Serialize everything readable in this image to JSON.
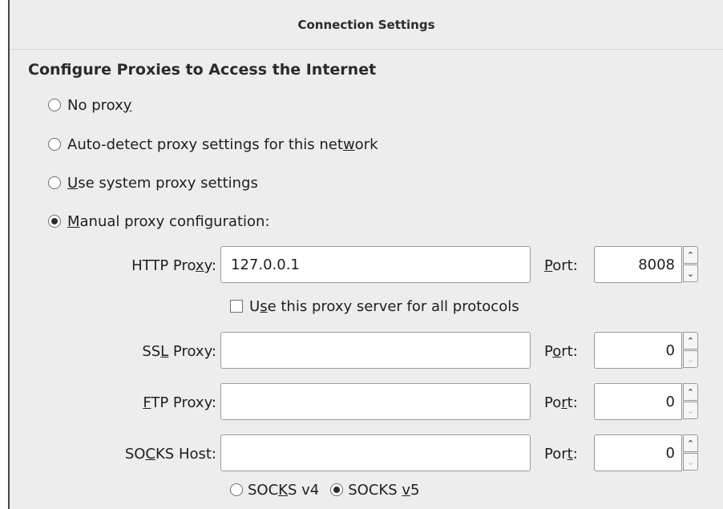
{
  "dialog": {
    "title": "Connection Settings",
    "section_heading": "Configure Proxies to Access the Internet"
  },
  "proxy_modes": [
    {
      "label_before": "No prox",
      "mnemonic": "y",
      "label_after": "",
      "checked": false
    },
    {
      "label_before": "Auto-detect proxy settings for this net",
      "mnemonic": "w",
      "label_after": "ork",
      "checked": false
    },
    {
      "label_before": "",
      "mnemonic": "U",
      "label_after": "se system proxy settings",
      "checked": false
    },
    {
      "label_before": "",
      "mnemonic": "M",
      "label_after": "anual proxy configuration:",
      "checked": true
    }
  ],
  "http": {
    "label_before": "HTTP Pro",
    "mnemonic": "x",
    "label_after": "y:",
    "value": "127.0.0.1",
    "port_mnemonic": "P",
    "port_label_after": "ort:",
    "port_value": "8008"
  },
  "share_all": {
    "label_before": "U",
    "mnemonic": "s",
    "label_after": "e this proxy server for all protocols",
    "checked": false
  },
  "ssl": {
    "label_before": "SS",
    "mnemonic": "L",
    "label_after": " Proxy:",
    "value": "",
    "port_before": "P",
    "port_mnemonic": "o",
    "port_after": "rt:",
    "port_value": "0"
  },
  "ftp": {
    "label_before": "",
    "mnemonic": "F",
    "label_after": "TP Proxy:",
    "value": "",
    "port_before": "Po",
    "port_mnemonic": "r",
    "port_after": "t:",
    "port_value": "0"
  },
  "socks": {
    "label_before": "SO",
    "mnemonic": "C",
    "label_after": "KS Host:",
    "value": "",
    "port_before": "Por",
    "port_mnemonic": "t",
    "port_after": ":",
    "port_value": "0"
  },
  "socks_versions": [
    {
      "label_before": "SOC",
      "mnemonic": "K",
      "label_after": "S v4",
      "checked": false
    },
    {
      "label_before": "SOCKS ",
      "mnemonic": "v",
      "label_after": "5",
      "checked": true
    }
  ]
}
